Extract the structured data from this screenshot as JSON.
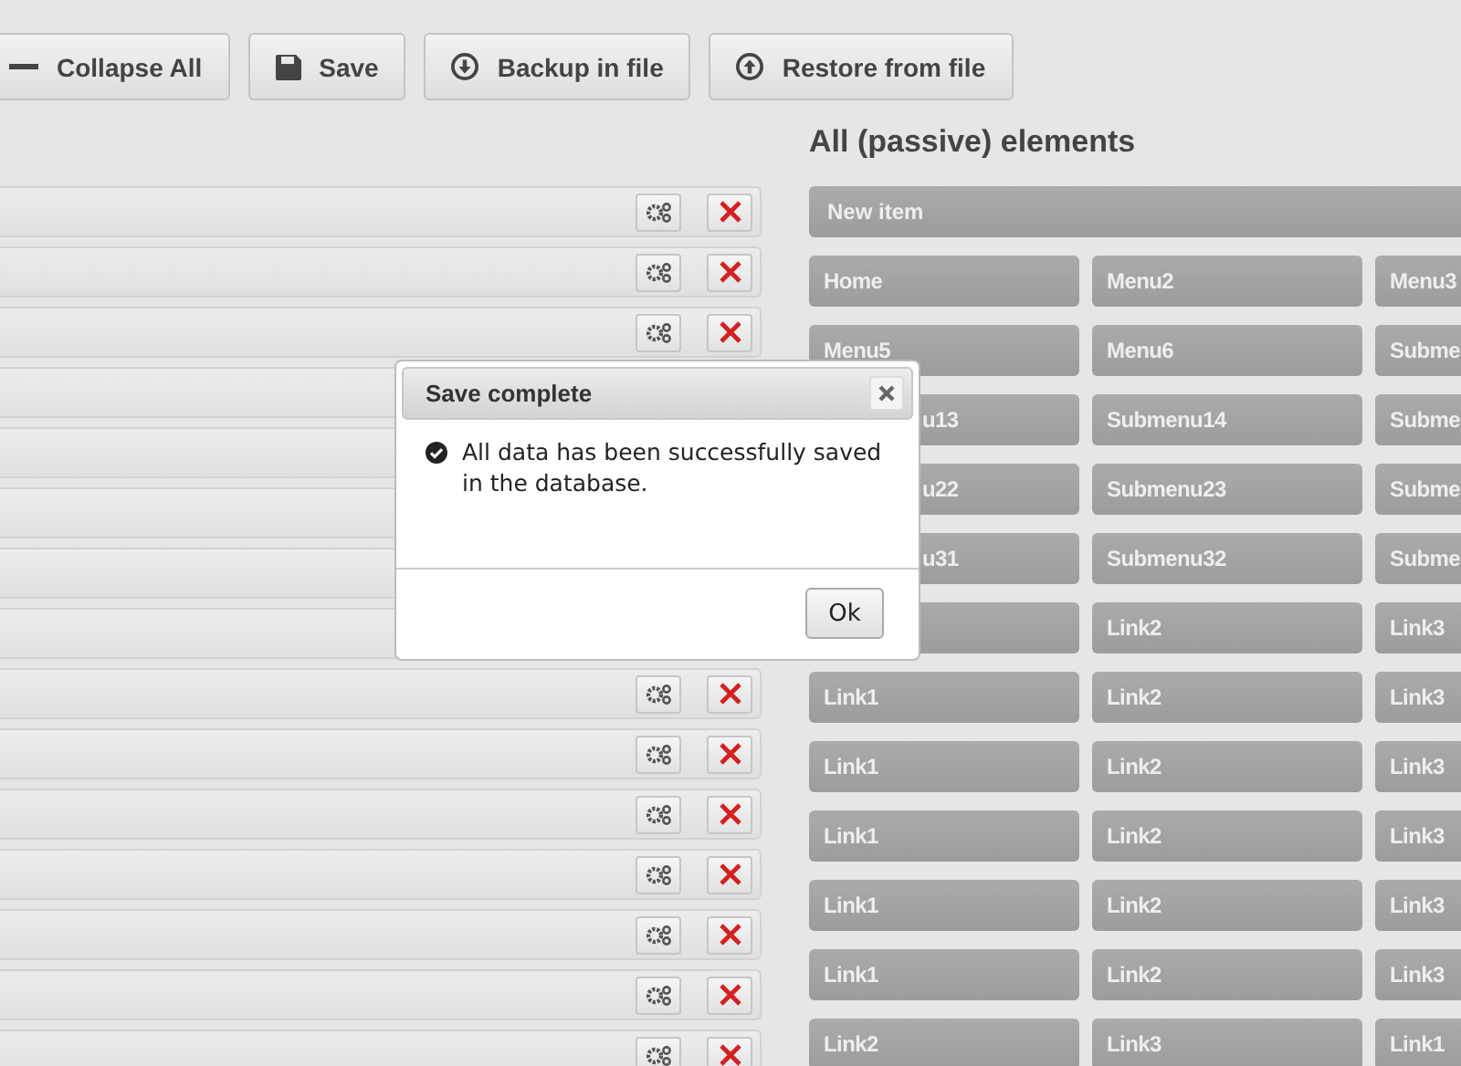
{
  "toolbar": [
    {
      "kind": "collapse",
      "label": "Collapse All"
    },
    {
      "kind": "save",
      "label": "Save"
    },
    {
      "kind": "backup",
      "label": "Backup in file"
    },
    {
      "kind": "restore",
      "label": "Restore from file"
    }
  ],
  "elements": {
    "title": "All (passive) elements",
    "new_item": "New item",
    "rows": [
      [
        {
          "label": "Home"
        },
        {
          "label": "Menu2"
        },
        {
          "label": "Menu3"
        }
      ],
      [
        {
          "label": "Menu5"
        },
        {
          "label": "Menu6"
        },
        {
          "label": "Subme"
        }
      ],
      [
        {
          "label": "u13",
          "covered": true
        },
        {
          "label": "Submenu14"
        },
        {
          "label": "Subme"
        }
      ],
      [
        {
          "label": "u22",
          "covered": true
        },
        {
          "label": "Submenu23"
        },
        {
          "label": "Subme"
        }
      ],
      [
        {
          "label": "u31",
          "covered": true
        },
        {
          "label": "Submenu32"
        },
        {
          "label": "Subme"
        }
      ],
      [
        {
          "covered": true
        },
        {
          "label": "Link2"
        },
        {
          "label": "Link3"
        }
      ],
      [
        {
          "label": "Link1"
        },
        {
          "label": "Link2"
        },
        {
          "label": "Link3"
        }
      ],
      [
        {
          "label": "Link1"
        },
        {
          "label": "Link2"
        },
        {
          "label": "Link3"
        }
      ],
      [
        {
          "label": "Link1"
        },
        {
          "label": "Link2"
        },
        {
          "label": "Link3"
        }
      ],
      [
        {
          "label": "Link1"
        },
        {
          "label": "Link2"
        },
        {
          "label": "Link3"
        }
      ],
      [
        {
          "label": "Link1"
        },
        {
          "label": "Link2"
        },
        {
          "label": "Link3"
        }
      ],
      [
        {
          "label": "Link2"
        },
        {
          "label": "Link3"
        },
        {
          "label": "Link1"
        }
      ]
    ]
  },
  "dialog": {
    "title": "Save complete",
    "message": "All data has been successfully saved in the database.",
    "button": "Ok"
  }
}
